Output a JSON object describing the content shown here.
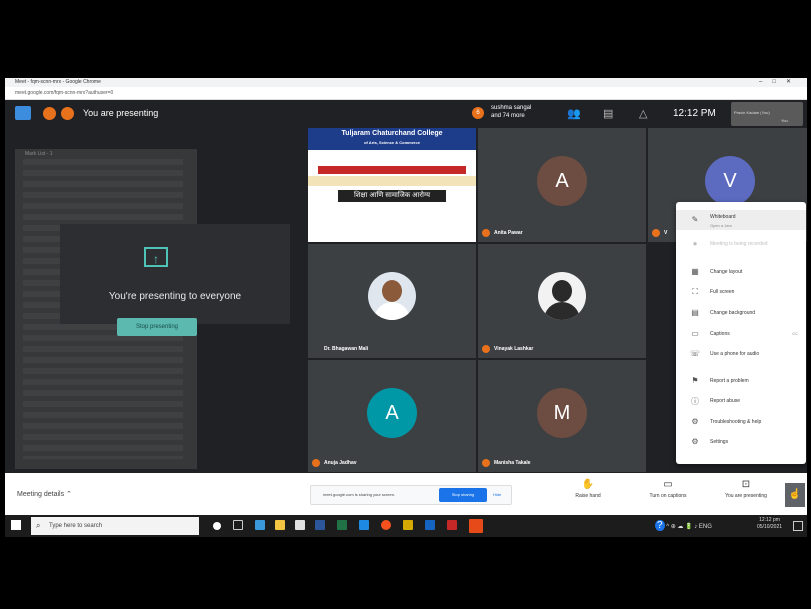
{
  "browser": {
    "title": "Meet - fqm-scnn-mrx - Google Chrome",
    "url": "meet.google.com/fqm-scnn-mrx?authuser=0"
  },
  "topbar": {
    "presenting_label": "You are presenting",
    "participants_count_badge": "6",
    "participants_line1": "sushma sangal",
    "participants_line2": "and 74 more",
    "time": "12:12 PM",
    "self_name": "Pravin Kadam (You)",
    "self_tag": "You"
  },
  "presenting": {
    "message": "You're presenting to everyone",
    "stop_label": "Stop presenting",
    "panel_title": "Mark List - 1"
  },
  "slide": {
    "header": "Tuljaram Chaturchand College",
    "subheader": "of Arts, Science & Commerce",
    "title": "शिक्षा आणि सामाजिक आरोग्य"
  },
  "tiles": [
    {
      "name": "Anita Pawar",
      "initial": "A",
      "color": "#6d4c41"
    },
    {
      "name": "V",
      "initial": "V",
      "color": "#5c6bc0"
    },
    {
      "name": "Dr. Bhagawan Mali",
      "initial": "",
      "color": ""
    },
    {
      "name": "Vinayak Lashkar",
      "initial": "",
      "color": ""
    },
    {
      "name": "Anuja Jadhav",
      "initial": "A",
      "color": "#0097a7"
    },
    {
      "name": "Manisha Takale",
      "initial": "M",
      "color": "#6d4c41"
    }
  ],
  "menu": {
    "items": [
      {
        "icon": "✎",
        "label": "Whiteboard",
        "sub": "Open a Jam"
      },
      {
        "icon": "●",
        "label": "Meeting is being recorded",
        "sub": ""
      },
      {
        "icon": "▦",
        "label": "Change layout",
        "sub": ""
      },
      {
        "icon": "⛶",
        "label": "Full screen",
        "sub": ""
      },
      {
        "icon": "▤",
        "label": "Change background",
        "sub": ""
      },
      {
        "icon": "▭",
        "label": "Captions",
        "sub": ""
      },
      {
        "icon": "☏",
        "label": "Use a phone for audio",
        "sub": ""
      },
      {
        "icon": "⚑",
        "label": "Report a problem",
        "sub": ""
      },
      {
        "icon": "ⓘ",
        "label": "Report abuse",
        "sub": ""
      },
      {
        "icon": "⚙",
        "label": "Troubleshooting & help",
        "sub": ""
      },
      {
        "icon": "⚙",
        "label": "Settings",
        "sub": ""
      }
    ],
    "captions_shortcut": "CC"
  },
  "bottombar": {
    "meeting_details": "Meeting details",
    "share_text": "meet.google.com is sharing your screen.",
    "stop_sharing": "Stop sharing",
    "hide": "Hide",
    "raise_hand": "Raise hand",
    "captions": "Turn on captions",
    "presenting": "You are presenting"
  },
  "taskbar": {
    "search_placeholder": "Type here to search",
    "time": "12:12 pm",
    "date": "05/10/2021",
    "lang": "ENG"
  }
}
